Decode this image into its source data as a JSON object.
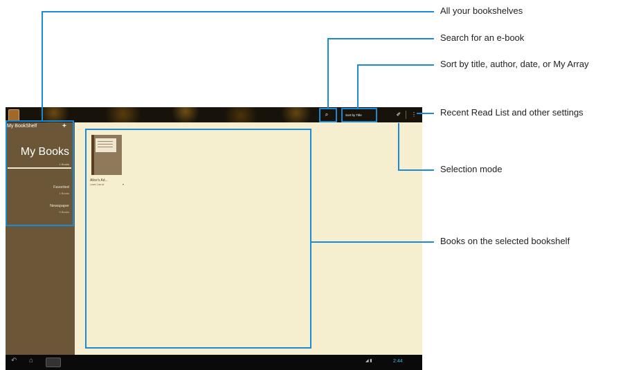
{
  "callouts": {
    "bookshelves": "All your bookshelves",
    "search": "Search for an e-book",
    "sort": "Sort by title, author, date, or My Array",
    "recent": "Recent Read List and other settings",
    "selection": "Selection mode",
    "books": "Books on the selected bookshelf"
  },
  "sidebar": {
    "header": "My BookShelf",
    "add_icon": "+",
    "current_shelf": "My Books",
    "current_count": "1 Books",
    "shelves": [
      {
        "name": "Favorited",
        "count": "1 Books"
      },
      {
        "name": "Newspaper",
        "count": "0 Books"
      }
    ]
  },
  "toolbar": {
    "search_icon": "⌕",
    "sort_label": "Sort by Title",
    "select_icon": "✐",
    "menu_icon": "⋮"
  },
  "book": {
    "title": "Alice's Ad...",
    "author": "Lewis Carroll",
    "arrow": "▾"
  },
  "navbar": {
    "back_icon": "↶",
    "home_icon": "⌂",
    "clock": "2:44",
    "status": "◢ ▮"
  },
  "colors": {
    "highlight": "#1a8ad6",
    "sidebar": "#6b5637",
    "content": "#f6efcf"
  }
}
